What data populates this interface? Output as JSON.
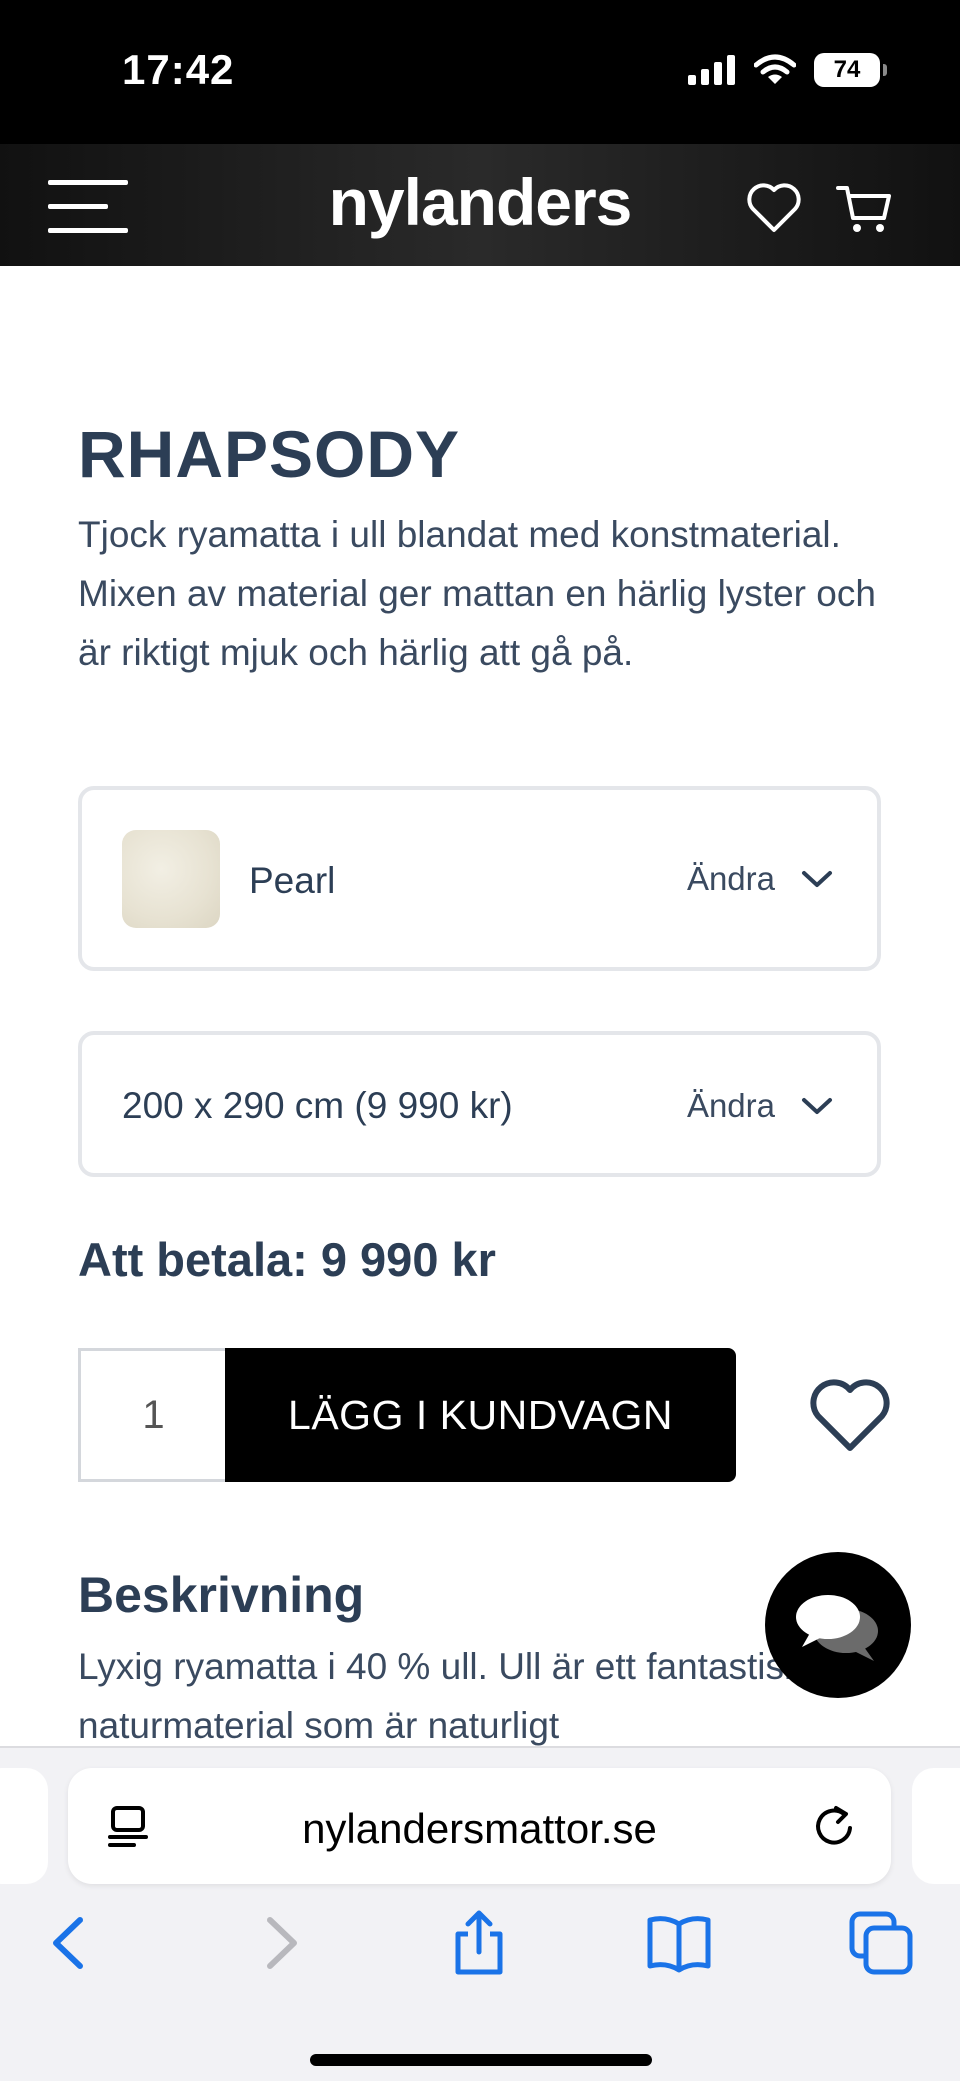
{
  "status_bar": {
    "time": "17:42",
    "battery": "74",
    "icons": [
      "signal-icon",
      "wifi-icon",
      "battery-icon"
    ]
  },
  "header": {
    "logo": "nylanders",
    "icons": [
      "menu-icon",
      "heart-icon",
      "cart-icon"
    ]
  },
  "product": {
    "title": "RHAPSODY",
    "description": "Tjock ryamatta i ull blandat med konstmaterial. Mixen av material ger mattan en härlig lyster och är riktigt mjuk och härlig att gå på."
  },
  "options": {
    "color": {
      "value": "Pearl",
      "change_label": "Ändra"
    },
    "size": {
      "value": "200 x 290 cm (9 990 kr)",
      "change_label": "Ändra"
    }
  },
  "purchase": {
    "total": "Att betala: 9 990 kr",
    "quantity": "1",
    "add_to_cart_label": "LÄGG I KUNDVAGN"
  },
  "details": {
    "heading": "Beskrivning",
    "body": "Lyxig ryamatta i 40 % ull. Ull är ett fantastiskt naturmaterial som är naturligt"
  },
  "browser": {
    "url": "nylandersmattor.se",
    "toolbar": [
      "back-icon",
      "forward-icon",
      "share-icon",
      "bookmarks-icon",
      "tabs-icon"
    ]
  },
  "colors": {
    "text_primary": "#2c3e55",
    "header_bg": "#1a1a1a",
    "button_bg": "#000000",
    "safari_blue": "#1a73e8"
  }
}
